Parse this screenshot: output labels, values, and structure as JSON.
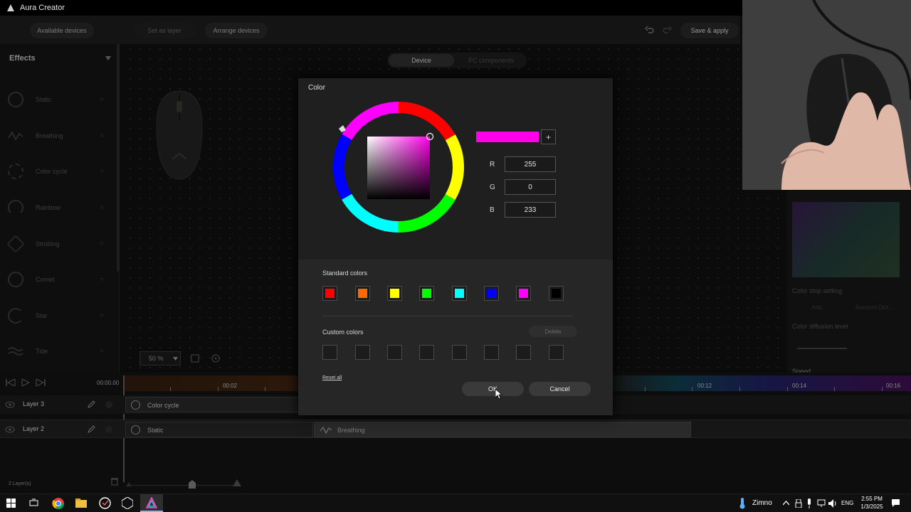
{
  "app": {
    "title": "Aura Creator"
  },
  "toolbar": {
    "available_devices": "Available devices",
    "set_as_layer": "Set as layer",
    "arrange_devices": "Arrange devices",
    "save_apply": "Save & apply"
  },
  "effects": {
    "title": "Effects",
    "items": [
      "Static",
      "Breathing",
      "Color cycle",
      "Rainbow",
      "Strobing",
      "Comet",
      "Star",
      "Tide"
    ]
  },
  "canvas": {
    "tabs": [
      "Device",
      "PC components"
    ],
    "zoom": "50 %"
  },
  "color_dialog": {
    "title": "Color",
    "r_label": "R",
    "g_label": "G",
    "b_label": "B",
    "r_value": "255",
    "g_value": "0",
    "b_value": "233",
    "preview_color": "#ff00e9",
    "add_label": "+",
    "standard_colors_label": "Standard colors",
    "standard_colors": [
      "#ff0000",
      "#ff6a00",
      "#ffff00",
      "#00ff00",
      "#00ffff",
      "#0000ff",
      "#ff00ff",
      "#000000"
    ],
    "custom_colors_label": "Custom colors",
    "delete_label": "Delete",
    "reset_all_label": "Reset all",
    "ok_label": "OK",
    "cancel_label": "Cancel"
  },
  "right_panel": {
    "color_stop_setting": "Color stop setting",
    "add_label": "Add",
    "random_label": "Random Dist...",
    "color_diffusion_level": "Color diffusion level",
    "speed": "Speed"
  },
  "timeline": {
    "times": [
      "00:00.00",
      "00:02",
      "00:12",
      "00:14",
      "00:16"
    ],
    "layers": [
      {
        "name": "Layer 3",
        "effect": "Color cycle"
      },
      {
        "name": "Layer 2",
        "effect": "Static",
        "second_effect": "Breathing"
      }
    ],
    "layer_count": "2 Layer(s)"
  },
  "taskbar": {
    "weather": "Zimno",
    "lang": "ENG",
    "time": "2:55 PM",
    "date": "1/3/2025"
  }
}
